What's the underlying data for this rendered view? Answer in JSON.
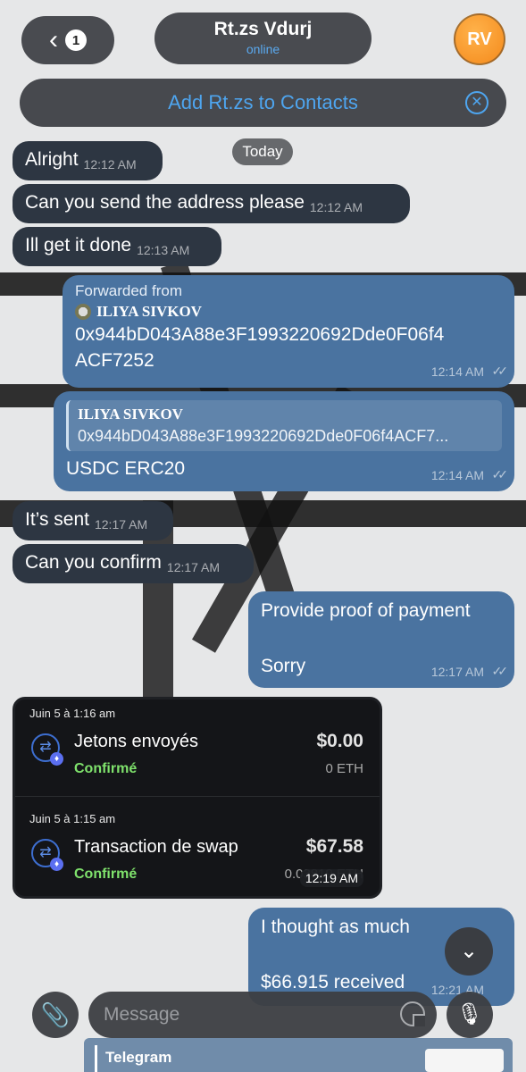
{
  "header": {
    "back_count": "1",
    "contact_name": "Rt.zs Vdurj",
    "contact_status": "online",
    "avatar_initials": "RV",
    "add_contact_label": "Add Rt.zs to Contacts"
  },
  "date_chip": "Today",
  "messages": [
    {
      "text": "Alright",
      "time": "12:12 AM"
    },
    {
      "text": "Can you send the address please",
      "time": "12:12 AM"
    },
    {
      "text": "Ill get it done",
      "time": "12:13 AM"
    },
    {
      "forwarded_label": "Forwarded from",
      "author": "ILIYA SIVKOV",
      "text_line1": "0x944bD043A88e3F1993220692Dde0F06f4",
      "text_line2": "ACF7252",
      "time": "12:14 AM"
    },
    {
      "quote_author": "ILIYA SIVKOV",
      "quote_text": "0x944bD043A88e3F1993220692Dde0F06f4ACF7...",
      "text": "USDC ERC20",
      "time": "12:14 AM"
    },
    {
      "text": "It’s sent",
      "time": "12:17 AM"
    },
    {
      "text": "Can you confirm",
      "time": "12:17 AM"
    },
    {
      "text_line1": "Provide proof of payment",
      "text_line2": "Sorry",
      "time": "12:17 AM"
    },
    {
      "text_line1": "I thought as much",
      "text_line2": "$66.915 received",
      "time": "12:21 AM"
    }
  ],
  "wallet": {
    "transactions": [
      {
        "date": "Juin 5 à 1:16 am",
        "name": "Jetons envoyés",
        "status": "Confirmé",
        "usd": "$0.00",
        "eth": "0 ETH",
        "icon": "swap-icon"
      },
      {
        "date": "Juin 5 à 1:15 am",
        "name": "Transaction de swap",
        "status": "Confirmé",
        "usd": "$67.58",
        "eth": "0.03819 ETH",
        "icon": "swap-icon"
      }
    ],
    "time": "12:19 AM"
  },
  "composer": {
    "placeholder": "Message",
    "preview_label": "Telegram"
  },
  "colors": {
    "incoming_bubble": "#2d3642",
    "outgoing_bubble": "#4a73a0",
    "link_accent": "#4ea5ef",
    "confirmed_green": "#7fe26c"
  }
}
